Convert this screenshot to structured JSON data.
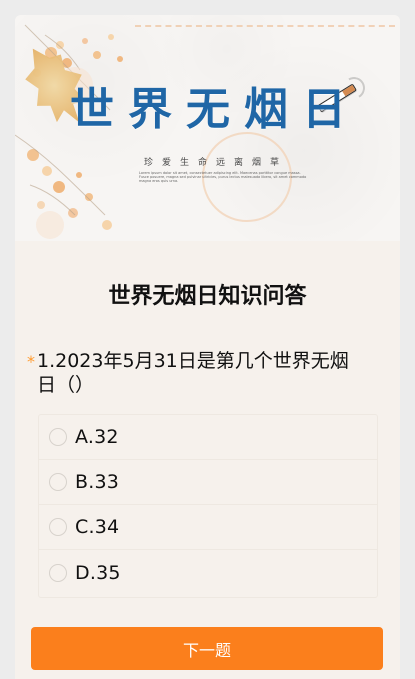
{
  "banner": {
    "title": "世界无烟日",
    "subtitle": "珍爱生命远离烟草",
    "fine_print": "Lorem ipsum dolor sit amet, consectetuer adipiscing elit. Maecenas porttitor congue massa. Fusce posuere, magna sed pulvinar ultricies, purus lectus malesuada libero, sit amet commodo magna eros quis urna."
  },
  "quiz": {
    "title": "世界无烟日知识问答",
    "question": {
      "required_mark": "*",
      "text": "1.2023年5月31日是第几个世界无烟日（）"
    },
    "options": [
      {
        "label": "A.32"
      },
      {
        "label": "B.33"
      },
      {
        "label": "C.34"
      },
      {
        "label": "D.35"
      }
    ],
    "next_button": "下一题"
  },
  "colors": {
    "page_bg": "#ececec",
    "card_bg": "#f6f1ec",
    "title_blue": "#1f66a6",
    "button_orange": "#fb7f1c",
    "required_orange": "#ff9a2e"
  }
}
